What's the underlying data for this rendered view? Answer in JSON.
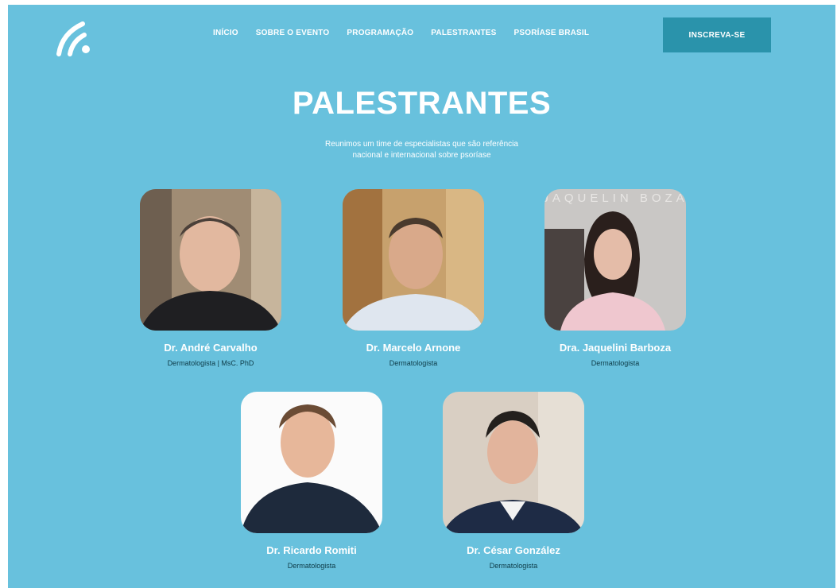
{
  "header": {
    "nav": [
      "INÍCIO",
      "SOBRE O EVENTO",
      "PROGRAMAÇÃO",
      "PALESTRANTES",
      "PSORÍASE BRASIL"
    ],
    "cta_label": "INSCREVA-SE"
  },
  "main": {
    "title": "PALESTRANTES",
    "subtitle_line1": "Reunimos um time de especialistas que são referência",
    "subtitle_line2": "nacional e internacional sobre psoríase",
    "speakers": [
      {
        "name": "Dr. André Carvalho",
        "role": "Dermatologista | MsC. PhD"
      },
      {
        "name": "Dr. Marcelo Arnone",
        "role": "Dermatologista"
      },
      {
        "name": "Dra. Jaquelini Barboza",
        "role": "Dermatologista",
        "photo_text": "JAQUELIN BOZA"
      },
      {
        "name": "Dr. Ricardo Romiti",
        "role": "Dermatologista"
      },
      {
        "name": "Dr. César González",
        "role": "Dermatologista"
      }
    ]
  },
  "colors": {
    "background": "#68c1dd",
    "button": "#2a93ab",
    "text": "#ffffff",
    "role_text": "#0d3b47"
  },
  "icons": {
    "logo": "wifi-signal-logo-icon"
  }
}
